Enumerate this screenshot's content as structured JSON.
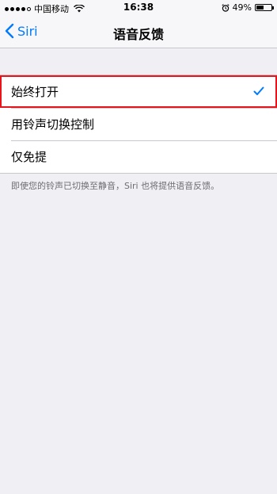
{
  "status_bar": {
    "carrier": "中国移动",
    "time": "16:38",
    "battery_percent": "49%",
    "battery_level": 0.49,
    "signal_strength": 4,
    "signal_max": 5,
    "icons": [
      "signal-icon",
      "wifi-icon",
      "alarm-icon",
      "battery-icon"
    ]
  },
  "nav": {
    "back_label": "Siri",
    "title": "语音反馈"
  },
  "options": {
    "items": [
      {
        "label": "始终打开",
        "selected": true
      },
      {
        "label": "用铃声切换控制",
        "selected": false
      },
      {
        "label": "仅免提",
        "selected": false
      }
    ]
  },
  "footnote": "即使您的铃声已切换至静音，Siri 也将提供语音反馈。",
  "colors": {
    "accent": "#007aff",
    "highlight_border": "#e8141b",
    "background": "#efeff4"
  }
}
